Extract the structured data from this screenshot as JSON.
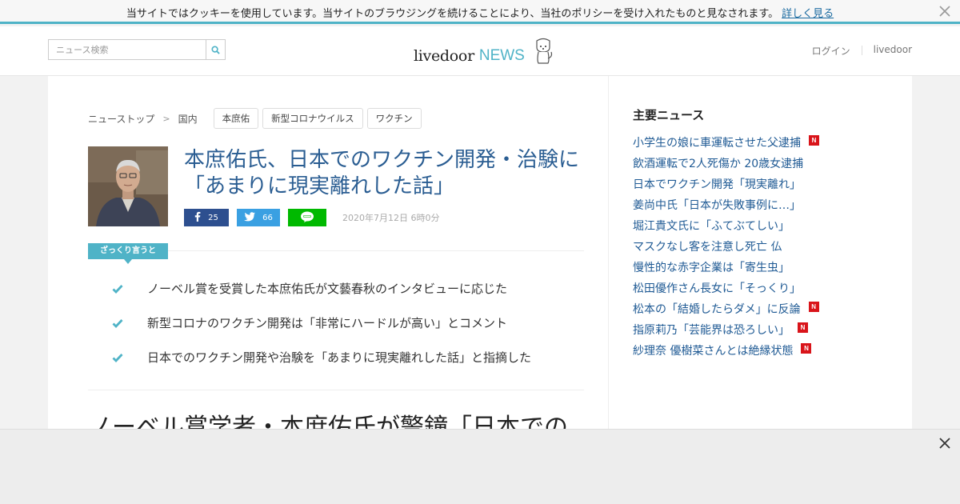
{
  "cookie": {
    "text": "当サイトではクッキーを使用しています。当サイトのブラウジングを続けることにより、当社のポリシーを受け入れたものと見なされます。",
    "link": "詳しく見る"
  },
  "header": {
    "search_placeholder": "ニュース検索",
    "logo_main": "livedoor",
    "logo_news": "NEWS",
    "login": "ログイン",
    "livedoor_link": "livedoor"
  },
  "article": {
    "breadcrumb": [
      "ニューストップ",
      "国内"
    ],
    "tags": [
      "本庶佑",
      "新型コロナウイルス",
      "ワクチン"
    ],
    "title": "本庶佑氏、日本でのワクチン開発・治験に「あまりに現実離れした話」",
    "share": {
      "facebook_count": "25",
      "twitter_count": "66"
    },
    "date": "2020年7月12日 6時0分",
    "summary_label": "ざっくり言うと",
    "points": [
      "ノーベル賞を受賞した本庶佑氏が文藝春秋のインタビューに応じた",
      "新型コロナのワクチン開発は「非常にハードルが高い」とコメント",
      "日本でのワクチン開発や治験を「あまりに現実離れした話」と指摘した"
    ],
    "lead_heading": "ノーベル賞学者・本庶佑氏が警鐘「日本での"
  },
  "sidebar": {
    "title": "主要ニュース",
    "items": [
      {
        "label": "小学生の娘に車運転させた父逮捕",
        "is_new": true
      },
      {
        "label": "飲酒運転で2人死傷か 20歳女逮捕",
        "is_new": false
      },
      {
        "label": "日本でワクチン開発「現実離れ」",
        "is_new": false
      },
      {
        "label": "姜尚中氏「日本が失敗事例に…」",
        "is_new": false
      },
      {
        "label": "堀江貴文氏に「ふてぶてしい」",
        "is_new": false
      },
      {
        "label": "マスクなし客を注意し死亡 仏",
        "is_new": false
      },
      {
        "label": "慢性的な赤字企業は「寄生虫」",
        "is_new": false
      },
      {
        "label": "松田優作さん長女に「そっくり」",
        "is_new": false
      },
      {
        "label": "松本の「結婚したらダメ」に反論",
        "is_new": true
      },
      {
        "label": "指原莉乃「芸能界は恐ろしい」",
        "is_new": true
      },
      {
        "label": "紗理奈 優樹菜さんとは絶縁状態",
        "is_new": true
      }
    ],
    "new_badge": "N"
  },
  "colors": {
    "accent": "#4fb3c7",
    "title_blue": "#2a5d92",
    "link_blue": "#1f5a94",
    "new_red": "#d9141a"
  }
}
